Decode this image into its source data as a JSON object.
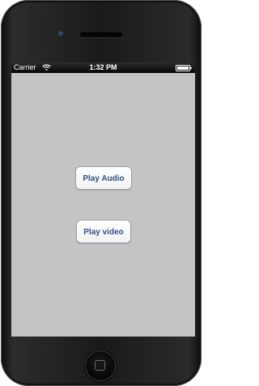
{
  "status_bar": {
    "carrier": "Carrier",
    "time": "1:32 PM",
    "wifi_icon": "wifi-icon",
    "battery_icon": "battery-icon"
  },
  "buttons": {
    "play_audio": "Play Audio",
    "play_video": "Play video"
  },
  "colors": {
    "screen_background": "#c4c4c4",
    "button_text": "#324f85",
    "status_bar": "#000000"
  }
}
